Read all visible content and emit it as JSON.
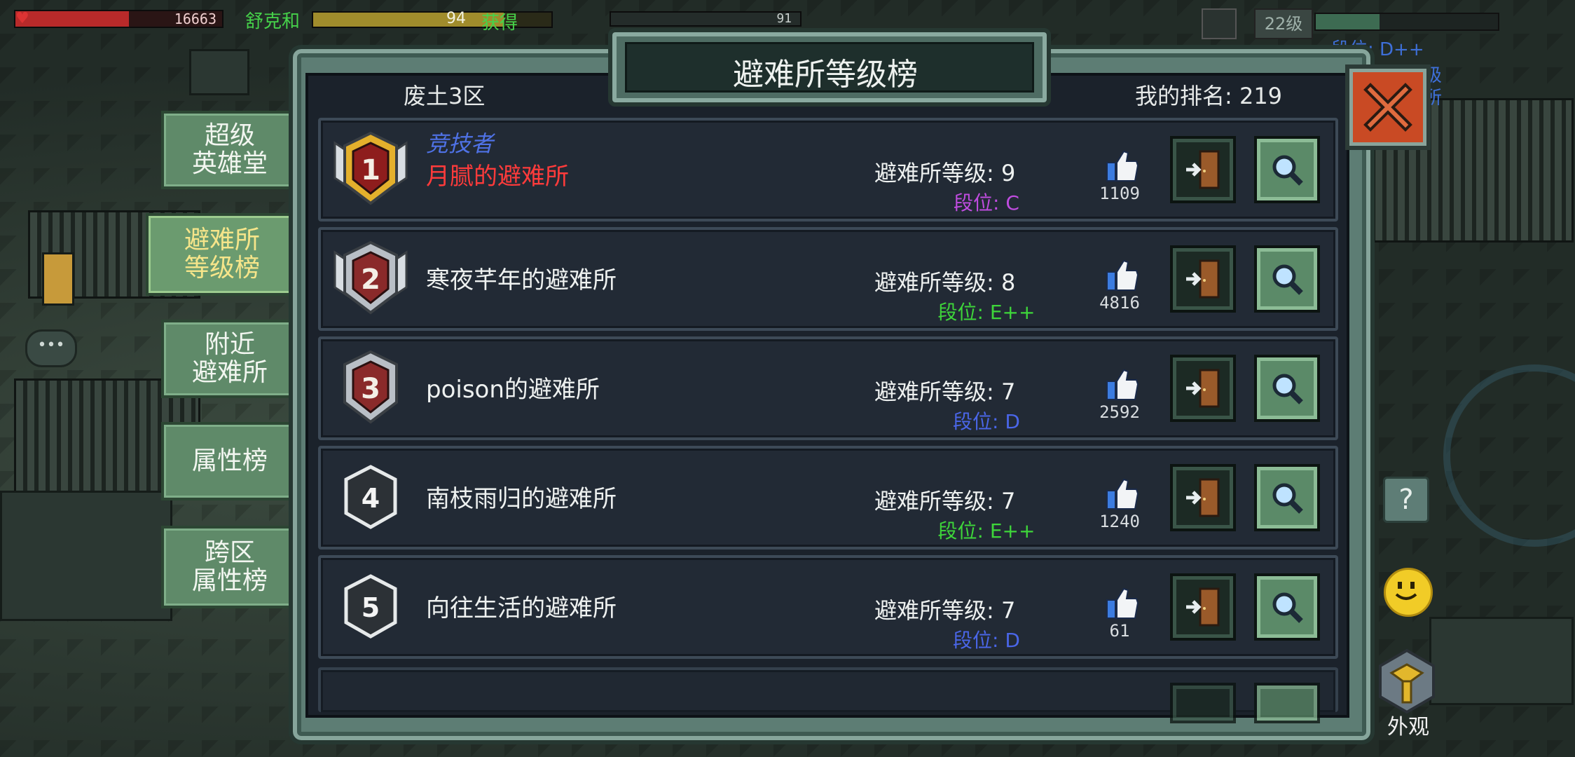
{
  "hud": {
    "hp_value": "16663",
    "ticker_text": "舒克和",
    "ticker_number": "94",
    "ticker_text_2": "获得",
    "bar2_value": "91",
    "level_label": "22级",
    "side_rank": "段位: D++",
    "side_rank_short": "级",
    "side_rank_short_2": "所"
  },
  "side_tabs": [
    {
      "line1": "超级",
      "line2": "英雄堂"
    },
    {
      "line1": "避难所",
      "line2": "等级榜"
    },
    {
      "line1": "附近",
      "line2": "避难所"
    },
    {
      "line1": "属性榜",
      "line2": ""
    },
    {
      "line1": "跨区",
      "line2": "属性榜"
    }
  ],
  "panel": {
    "title": "避难所等级榜",
    "server": "废土3区",
    "my_rank": "我的排名: 219"
  },
  "rows": [
    {
      "rank": "1",
      "alias": "竞技者",
      "name": "月腻的避难所",
      "level": "避难所等级: 9",
      "tier": "段位: C",
      "tier_color": "#c04ce0",
      "likes": "1109"
    },
    {
      "rank": "2",
      "alias": "",
      "name": "寒夜芊年的避难所",
      "level": "避难所等级: 8",
      "tier": "段位: E++",
      "tier_color": "#3ed63a",
      "likes": "4816"
    },
    {
      "rank": "3",
      "alias": "",
      "name": "poison的避难所",
      "level": "避难所等级: 7",
      "tier": "段位: D",
      "tier_color": "#4a66e8",
      "likes": "2592"
    },
    {
      "rank": "4",
      "alias": "",
      "name": "南枝雨归的避难所",
      "level": "避难所等级: 7",
      "tier": "段位: E++",
      "tier_color": "#3ed63a",
      "likes": "1240"
    },
    {
      "rank": "5",
      "alias": "",
      "name": "向往生活的避难所",
      "level": "避难所等级: 7",
      "tier": "段位: D",
      "tier_color": "#4a66e8",
      "likes": "61"
    }
  ],
  "right_buttons": {
    "help_glyph": "?",
    "look_label": "外观"
  },
  "colors": {
    "panel_frame": "#5d7d74",
    "row_bg": "#222a35",
    "close_red": "#c94a24",
    "active_tab_text": "#f6e58a",
    "alias_blue": "#4f72e6",
    "first_name_red": "#ff3b3b"
  }
}
